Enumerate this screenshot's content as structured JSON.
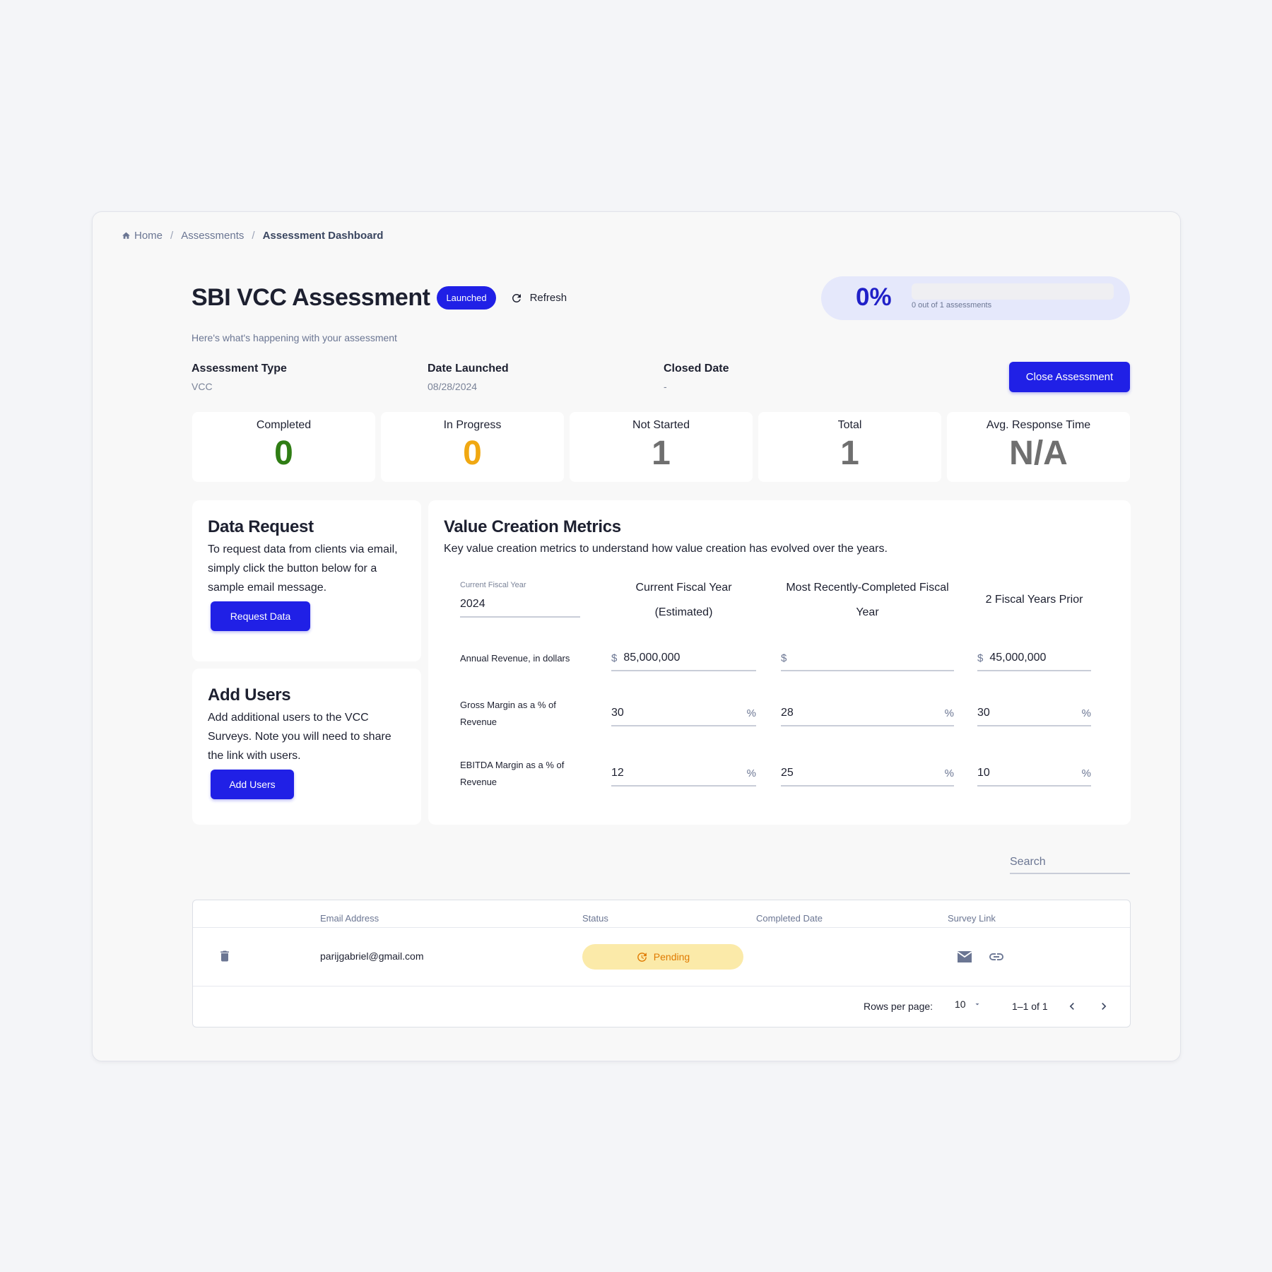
{
  "breadcrumb": {
    "home": "Home",
    "assessments": "Assessments",
    "current": "Assessment Dashboard"
  },
  "header": {
    "title": "SBI VCC Assessment",
    "badge": "Launched",
    "refresh_label": "Refresh",
    "subtitle": "Here's what's happening with your assessment"
  },
  "progress": {
    "percent_label": "0%",
    "fraction": 0,
    "caption": "0 out of 1 assessments"
  },
  "meta": {
    "type_label": "Assessment Type",
    "type_value": "VCC",
    "launched_label": "Date Launched",
    "launched_value": "08/28/2024",
    "closed_label": "Closed Date",
    "closed_value": "-"
  },
  "close_button": "Close Assessment",
  "stats": [
    {
      "label": "Completed",
      "value": "0",
      "color": "#2f7d14"
    },
    {
      "label": "In Progress",
      "value": "0",
      "color": "#f0a812"
    },
    {
      "label": "Not Started",
      "value": "1",
      "color": "#6f6f6f"
    },
    {
      "label": "Total",
      "value": "1",
      "color": "#6f6f6f"
    },
    {
      "label": "Avg. Response Time",
      "value": "N/A",
      "color": "#6f6f6f"
    }
  ],
  "data_request": {
    "title": "Data Request",
    "desc": "To request data from clients via email, simply click the button below for a sample email message.",
    "button": "Request Data"
  },
  "add_users": {
    "title": "Add Users",
    "desc": "Add additional users to the VCC Surveys. Note you will need to share the link with users.",
    "button": "Add Users"
  },
  "vcm": {
    "title": "Value Creation Metrics",
    "subtitle": "Key value creation metrics to understand how value creation has evolved over the years.",
    "fiscal_year_label": "Current Fiscal Year",
    "fiscal_year_value": "2024",
    "columns": [
      "Current Fiscal Year (Estimated)",
      "Most Recently-Completed Fiscal Year",
      "2 Fiscal Years Prior"
    ],
    "rows": [
      {
        "label": "Annual Revenue, in dollars",
        "unit": "$",
        "values": [
          "85,000,000",
          "",
          "45,000,000"
        ]
      },
      {
        "label": "Gross Margin as a % of Revenue",
        "unit": "%",
        "values": [
          "30",
          "28",
          "30"
        ]
      },
      {
        "label": "EBITDA Margin as a % of Revenue",
        "unit": "%",
        "values": [
          "12",
          "25",
          "10"
        ]
      }
    ]
  },
  "search": {
    "placeholder": "Search"
  },
  "table": {
    "headers": [
      "Email Address",
      "Status",
      "Completed Date",
      "Survey Link"
    ],
    "rows": [
      {
        "email": "parijgabriel@gmail.com",
        "status": "Pending",
        "completed_date": ""
      }
    ],
    "rows_per_page_label": "Rows per page:",
    "rows_per_page": "10",
    "range": "1–1 of 1"
  },
  "colors": {
    "accent": "#2020e6",
    "pending_bg": "#fbeaa9",
    "pending_text": "#e07a00"
  }
}
